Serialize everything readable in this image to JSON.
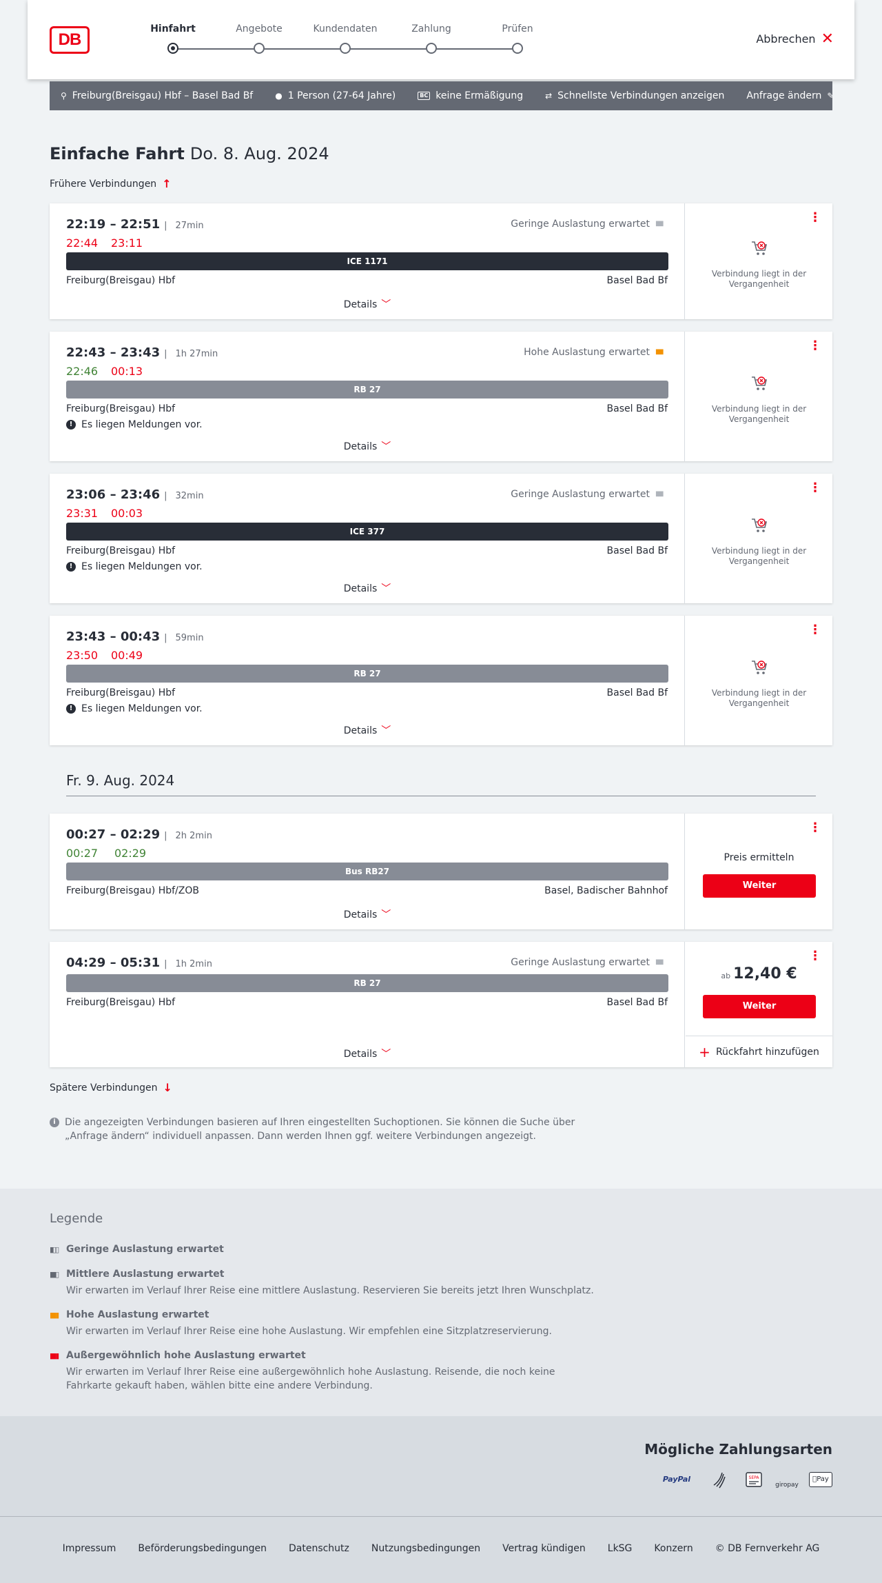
{
  "header": {
    "logo": "DB",
    "steps": [
      "Hinfahrt",
      "Angebote",
      "Kundendaten",
      "Zahlung",
      "Prüfen"
    ],
    "cancel_label": "Abbrechen"
  },
  "filter": {
    "route": "Freiburg(Breisgau) Hbf – Basel Bad Bf",
    "persons": "1 Person (27-64 Jahre)",
    "discount": "keine Ermäßigung",
    "fastest": "Schnellste Verbindungen anzeigen",
    "change": "Anfrage ändern"
  },
  "heading": {
    "title": "Einfache Fahrt",
    "date": "Do. 8. Aug. 2024"
  },
  "earlier_label": "Frühere Verbindungen",
  "later_label": "Spätere Verbindungen",
  "date_separator": "Fr. 9. Aug. 2024",
  "details_label": "Details",
  "past_text": "Verbindung liegt in der Vergangenheit",
  "connections": [
    {
      "time": "22:19 – 22:51",
      "duration": "27min",
      "rt_dep": "22:44",
      "rt_arr": "23:11",
      "load": "Geringe Auslastung erwartet",
      "train": "ICE 1171",
      "from": "Freiburg(Breisgau) Hbf",
      "to": "Basel Bad Bf"
    },
    {
      "time": "22:43 – 23:43",
      "duration": "1h 27min",
      "rt_dep": "22:46",
      "rt_arr": "00:13",
      "load": "Hohe Auslastung erwartet",
      "train": "RB 27",
      "from": "Freiburg(Breisgau) Hbf",
      "to": "Basel Bad Bf",
      "message": "Es liegen Meldungen vor."
    },
    {
      "time": "23:06 – 23:46",
      "duration": "32min",
      "rt_dep": "23:31",
      "rt_arr": "00:03",
      "load": "Geringe Auslastung erwartet",
      "train": "ICE 377",
      "from": "Freiburg(Breisgau) Hbf",
      "to": "Basel Bad Bf",
      "message": "Es liegen Meldungen vor."
    },
    {
      "time": "23:43 – 00:43",
      "duration": "59min",
      "rt_dep": "23:50",
      "rt_arr": "00:49",
      "train": "RB 27",
      "from": "Freiburg(Breisgau) Hbf",
      "to": "Basel Bad Bf",
      "message": "Es liegen Meldungen vor."
    },
    {
      "time": "00:27 – 02:29",
      "duration": "2h 2min",
      "rt_dep": "00:27",
      "rt_arr": "02:29",
      "train": "Bus RB27",
      "from": "Freiburg(Breisgau) Hbf/ZOB",
      "to": "Basel, Badischer Bahnhof",
      "price_label": "Preis ermitteln",
      "button": "Weiter"
    },
    {
      "time": "04:29 – 05:31",
      "duration": "1h 2min",
      "load": "Geringe Auslastung erwartet",
      "train": "RB 27",
      "from": "Freiburg(Breisgau) Hbf",
      "to": "Basel Bad Bf",
      "price_prefix": "ab",
      "price": "12,40 €",
      "button": "Weiter",
      "return_label": "Rückfahrt hinzufügen"
    }
  ],
  "info_text": "Die angezeigten Verbindungen basieren auf Ihren eingestellten Suchoptionen. Sie können die Suche über „Anfrage ändern“ individuell anpassen. Dann werden Ihnen ggf. weitere Verbindungen angezeigt.",
  "legend": {
    "title": "Legende",
    "items": [
      {
        "title": "Geringe Auslastung erwartet",
        "text": ""
      },
      {
        "title": "Mittlere Auslastung erwartet",
        "text": "Wir erwarten im Verlauf Ihrer Reise eine mittlere Auslastung. Reservieren Sie bereits jetzt Ihren Wunschplatz."
      },
      {
        "title": "Hohe Auslastung erwartet",
        "text": "Wir erwarten im Verlauf Ihrer Reise eine hohe Auslastung. Wir empfehlen eine Sitzplatzreservierung."
      },
      {
        "title": "Außergewöhnlich hohe Auslastung erwartet",
        "text": "Wir erwarten im Verlauf Ihrer Reise eine außergewöhnlich hohe Auslastung. Reisende, die noch keine Fahrkarte gekauft haben, wählen bitte eine andere Verbindung."
      }
    ]
  },
  "payment": {
    "title": "Mögliche Zahlungsarten",
    "methods": [
      "PayPal",
      "",
      "",
      "giropay",
      "Pay"
    ]
  },
  "footer_links": [
    "Impressum",
    "Beförderungsbedingungen",
    "Datenschutz",
    "Nutzungsbedingungen",
    "Vertrag kündigen",
    "LkSG",
    "Konzern",
    "© DB Fernverkehr AG"
  ],
  "colors": {
    "accent": "#ec0016",
    "delay": "#ec0016",
    "ontime": "#408335",
    "dark": "#282d37",
    "grey_train": "#878c96",
    "high_load": "#f39200"
  }
}
